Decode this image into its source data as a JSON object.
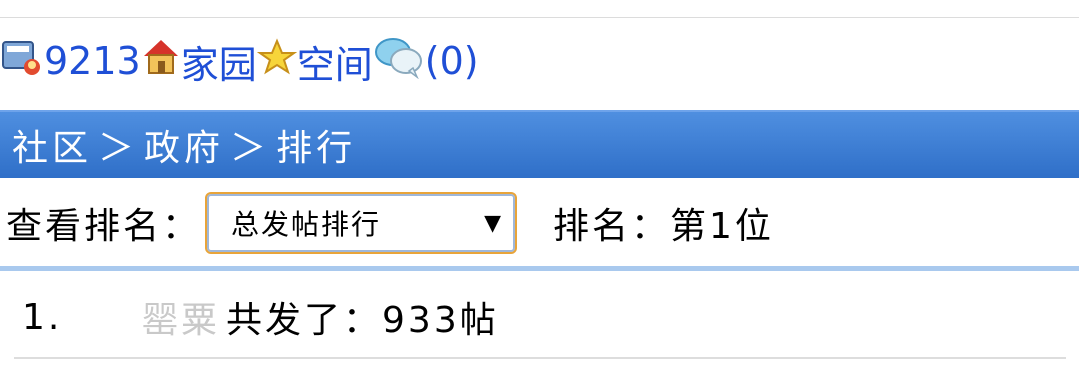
{
  "status_bar": {
    "user_id": "9213",
    "home_label": "家园",
    "space_label": "空间",
    "messages_count": "(0)",
    "icons": [
      "user-card-icon",
      "house-icon",
      "star-icon",
      "chat-bubbles-icon"
    ]
  },
  "breadcrumb": {
    "items": [
      "社区",
      "政府",
      "排行"
    ],
    "separator": "＞"
  },
  "ranking": {
    "view_label": "查看排名：",
    "select_value": "总发帖排行",
    "rank_text": "排名：第1位"
  },
  "list": [
    {
      "index": "1.",
      "user": "罂粟",
      "text": "共发了：933帖"
    }
  ],
  "colors": {
    "link": "#1f4fd6",
    "nav_bg": "#3f7fd6",
    "select_border": "#e8a43a",
    "muted_user": "#c9c9c9"
  }
}
